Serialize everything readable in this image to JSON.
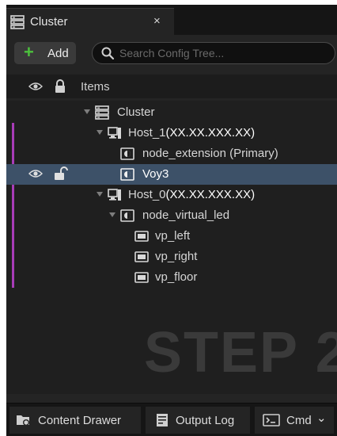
{
  "tab": {
    "title": "Cluster",
    "close": "×",
    "icon": "cluster-icon"
  },
  "toolbar": {
    "add_label": "Add",
    "add_icon": "plus-icon"
  },
  "search": {
    "placeholder": "Search Config Tree...",
    "value": "",
    "icon": "search-icon"
  },
  "header": {
    "items_label": "Items",
    "icons": [
      "eye-icon",
      "lock-icon"
    ]
  },
  "tree": [
    {
      "label": "Cluster",
      "icon": "cluster-icon",
      "expanded": true
    },
    {
      "label": "Host_1",
      "addr": "(XX.XX.XXX.XX)",
      "icon": "host-icon",
      "expanded": true
    },
    {
      "label": "node_extension",
      "suffix": "(Primary)",
      "icon": "node-icon"
    },
    {
      "label": "Voy3",
      "icon": "node-icon",
      "selected": true
    },
    {
      "label": "Host_0",
      "addr": "(XX.XX.XXX.XX)",
      "icon": "host-icon",
      "expanded": true
    },
    {
      "label": "node_virtual_led",
      "icon": "node-icon",
      "expanded": true
    },
    {
      "label": "vp_left",
      "icon": "viewport-icon"
    },
    {
      "label": "vp_right",
      "icon": "viewport-icon"
    },
    {
      "label": "vp_floor",
      "icon": "viewport-icon"
    }
  ],
  "watermark": "STEP 2",
  "bottom": {
    "content_drawer": "Content Drawer",
    "output_log": "Output Log",
    "cmd": "Cmd",
    "cmd_arrow": "⌄"
  },
  "colors": {
    "accent_green": "#4cc23d",
    "selection": "#3d5168",
    "host_marker": "#a83cb8",
    "panel": "#242424"
  }
}
